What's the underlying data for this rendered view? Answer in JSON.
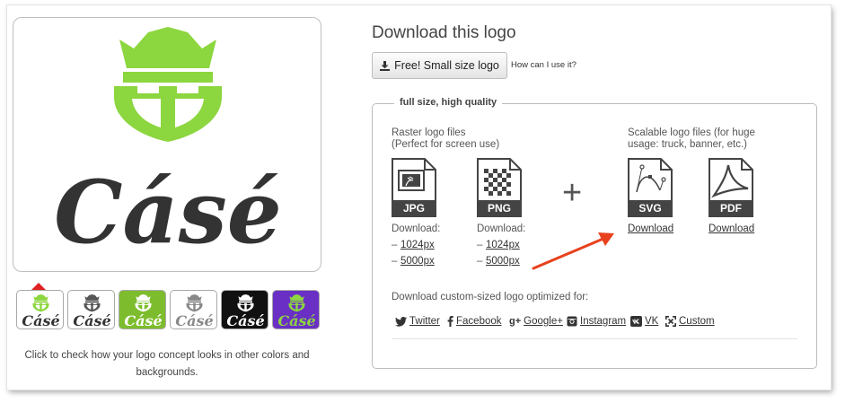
{
  "logo": {
    "text": "Cásé",
    "crown_color": "#8cd63f",
    "text_color": "#333333"
  },
  "swatches": [
    {
      "bg": "#ffffff",
      "crown": "#8cd63f",
      "text": "#333333",
      "text_label": "Cásé",
      "selected": true
    },
    {
      "bg": "#ffffff",
      "crown": "#555555",
      "text": "#333333",
      "text_label": "Cásé",
      "selected": false
    },
    {
      "bg": "#7dbd2d",
      "crown": "#ffffff",
      "text": "#ffffff",
      "text_label": "Cásé",
      "selected": false
    },
    {
      "bg": "#ffffff",
      "crown": "#888888",
      "text": "#888888",
      "text_label": "Cásé",
      "selected": false
    },
    {
      "bg": "#111111",
      "crown": "#ffffff",
      "text": "#ffffff",
      "text_label": "Cásé",
      "selected": false
    },
    {
      "bg": "#6a2fc4",
      "crown": "#8cd63f",
      "text": "#8cd63f",
      "text_label": "Cásé",
      "selected": false
    }
  ],
  "hint": "Click to check how your logo concept looks in other colors and backgrounds.",
  "title": "Download this logo",
  "free_button": "Free! Small size logo",
  "how_link": "How can I use it?",
  "fieldset_legend": "full size, high quality",
  "raster": {
    "heading_line1": "Raster logo files",
    "heading_line2": "(Perfect for screen use)",
    "jpg": {
      "label": "JPG",
      "download": "Download:",
      "dash": "–",
      "small": "1024px",
      "large": "5000px"
    },
    "png": {
      "label": "PNG",
      "download": "Download:",
      "dash": "–",
      "small": "1024px",
      "large": "5000px"
    }
  },
  "plus": "+",
  "vector": {
    "heading_line1": "Scalable logo files (for huge",
    "heading_line2": "usage: truck, banner, etc.)",
    "svg": {
      "label": "SVG",
      "link": "Download"
    },
    "pdf": {
      "label": "PDF",
      "link": "Download"
    }
  },
  "custom": {
    "label": "Download custom-sized logo optimized for:",
    "items": [
      {
        "icon": "twitter-icon",
        "label": "Twitter"
      },
      {
        "icon": "facebook-icon",
        "label": "Facebook"
      },
      {
        "icon": "google-plus-icon",
        "label": "Google+"
      },
      {
        "icon": "instagram-icon",
        "label": "Instagram"
      },
      {
        "icon": "vk-icon",
        "label": "VK"
      },
      {
        "icon": "custom-icon",
        "label": "Custom"
      }
    ]
  },
  "annotation_arrow_color": "#e8411e"
}
